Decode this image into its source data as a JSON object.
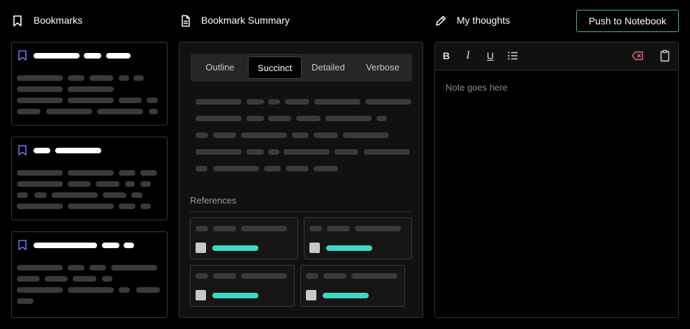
{
  "headers": {
    "bookmarks": "Bookmarks",
    "summary": "Bookmark Summary",
    "thoughts": "My thoughts",
    "push_button": "Push to Notebook"
  },
  "summary": {
    "tabs": [
      {
        "label": "Outline",
        "active": false
      },
      {
        "label": "Succinct",
        "active": true
      },
      {
        "label": "Detailed",
        "active": false
      },
      {
        "label": "Verbose",
        "active": false
      }
    ],
    "references_label": "References"
  },
  "editor": {
    "toolbar": {
      "bold": "B",
      "italic": "I",
      "underline": "U"
    },
    "placeholder": "Note goes here"
  },
  "icons": {
    "bookmark": "bookmark-icon",
    "document": "document-icon",
    "pencil": "pencil-icon",
    "list": "list-icon",
    "clear": "clear-format-icon",
    "clipboard": "clipboard-icon"
  },
  "colors": {
    "accent_teal": "#3fd9c2",
    "bookmark_blue": "#6b7cff",
    "clear_red": "#e06b7a",
    "button_border": "#3fb8a8"
  }
}
